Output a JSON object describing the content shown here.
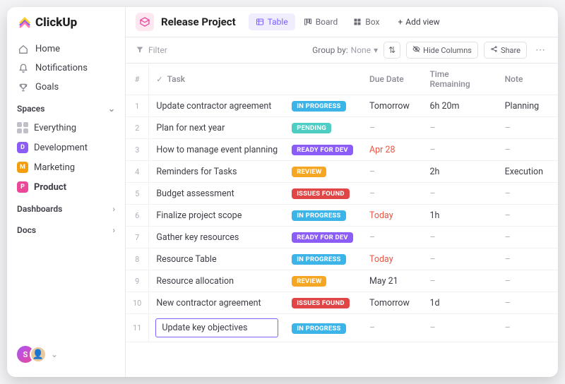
{
  "brand": "ClickUp",
  "sidebar": {
    "nav": [
      {
        "label": "Home"
      },
      {
        "label": "Notifications"
      },
      {
        "label": "Goals"
      }
    ],
    "spaces_header": "Spaces",
    "everything": "Everything",
    "spaces": [
      {
        "label": "Development",
        "letter": "D",
        "color": "#8b5cf6"
      },
      {
        "label": "Marketing",
        "letter": "M",
        "color": "#f59e0b"
      },
      {
        "label": "Product",
        "letter": "P",
        "color": "#ec4899",
        "active": true
      }
    ],
    "dashboards": "Dashboards",
    "docs": "Docs",
    "user_initial": "S"
  },
  "header": {
    "project_title": "Release Project",
    "views": [
      {
        "label": "Table",
        "active": true
      },
      {
        "label": "Board"
      },
      {
        "label": "Box"
      }
    ],
    "add_view": "Add view"
  },
  "toolbar": {
    "filter": "Filter",
    "group_by_label": "Group by:",
    "group_by_value": "None",
    "hide_columns": "Hide Columns",
    "share": "Share"
  },
  "columns": {
    "num": "#",
    "task": "Task",
    "due": "Due Date",
    "time": "Time Remaining",
    "note": "Note"
  },
  "status_colors": {
    "IN PROGRESS": "#3cb4e7",
    "PENDING": "#4ecdc4",
    "READY FOR DEV": "#8b5cf6",
    "REVIEW": "#f5a623",
    "ISSUES FOUND": "#e04646"
  },
  "rows": [
    {
      "n": 1,
      "task": "Update contractor agreement",
      "status": "IN PROGRESS",
      "due": "Tomorrow",
      "due_red": false,
      "time": "6h 20m",
      "note": "Planning"
    },
    {
      "n": 2,
      "task": "Plan for next year",
      "status": "PENDING",
      "due": "–",
      "time": "–",
      "note": "–"
    },
    {
      "n": 3,
      "task": "How to manage event planning",
      "status": "READY FOR DEV",
      "due": "Apr 28",
      "due_red": true,
      "time": "–",
      "note": "–"
    },
    {
      "n": 4,
      "task": "Reminders for Tasks",
      "status": "REVIEW",
      "due": "–",
      "time": "2h",
      "note": "Execution"
    },
    {
      "n": 5,
      "task": "Budget assessment",
      "status": "ISSUES FOUND",
      "due": "–",
      "time": "–",
      "note": "–"
    },
    {
      "n": 6,
      "task": "Finalize project scope",
      "status": "IN PROGRESS",
      "due": "Today",
      "due_red": true,
      "time": "1h",
      "note": "–"
    },
    {
      "n": 7,
      "task": "Gather key resources",
      "status": "READY FOR DEV",
      "due": "–",
      "time": "–",
      "note": "–"
    },
    {
      "n": 8,
      "task": "Resource Table",
      "status": "IN PROGRESS",
      "due": "Today",
      "due_red": true,
      "time": "–",
      "note": "–"
    },
    {
      "n": 9,
      "task": "Resource allocation",
      "status": "REVIEW",
      "due": "May 21",
      "time": "–",
      "note": "–"
    },
    {
      "n": 10,
      "task": "New contractor agreement",
      "status": "ISSUES FOUND",
      "due": "Tomorrow",
      "time": "1d",
      "note": "–"
    },
    {
      "n": 11,
      "task": "Update key objectives",
      "status": "IN PROGRESS",
      "due": "–",
      "time": "–",
      "note": "–",
      "editing": true
    }
  ]
}
